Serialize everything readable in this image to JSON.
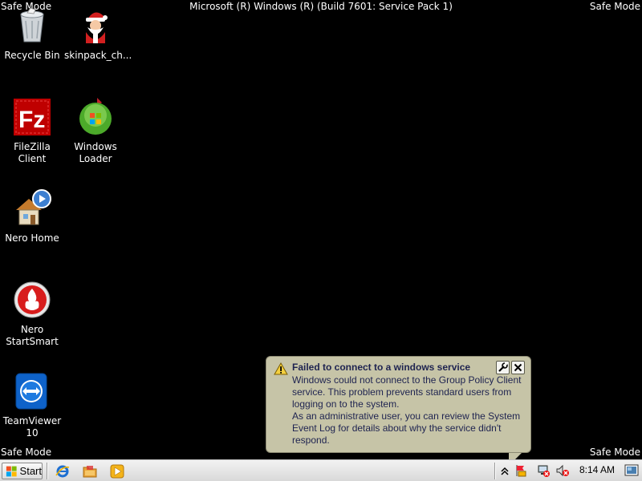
{
  "overlay": {
    "safe_mode_label": "Safe Mode",
    "build_text": "Microsoft (R) Windows (R) (Build 7601: Service Pack 1)"
  },
  "desktop": {
    "icons": [
      {
        "label": "Recycle Bin",
        "icon": "recycle-bin-icon"
      },
      {
        "label": "skinpack_ch...",
        "icon": "santa-icon"
      },
      {
        "label": "FileZilla Client",
        "icon": "filezilla-icon"
      },
      {
        "label": "Windows\nLoader",
        "icon": "windows-loader-icon"
      },
      {
        "label": "Nero Home",
        "icon": "nero-home-icon"
      },
      {
        "label": "Nero\nStartSmart",
        "icon": "nero-startsmart-icon"
      },
      {
        "label": "TeamViewer\n10",
        "icon": "teamviewer-icon"
      }
    ]
  },
  "balloon": {
    "title": "Failed to connect to a windows service",
    "body": "Windows could not connect to the Group Policy Client service. This problem prevents standard users from logging on to the system.\nAs an administrative user, you can review the System Event Log for details about why the service didn't respond.",
    "warning_icon": "warning-icon",
    "settings_icon": "settings-icon",
    "close_icon": "close-icon"
  },
  "taskbar": {
    "start_label": "Start",
    "quick_launch": [
      "internet-explorer-icon",
      "file-explorer-icon",
      "media-player-icon"
    ],
    "tray": {
      "icons": [
        "show-hidden-icons-icon",
        "action-center-icon",
        "network-disconnected-icon",
        "volume-muted-icon"
      ],
      "clock": "8:14 AM",
      "show_desktop_icon": "show-desktop-icon"
    }
  },
  "colors": {
    "desktop_bg": "#000000",
    "balloon_bg": "#c6c4a7",
    "balloon_text": "#1e2350",
    "taskbar_bg": "#e0e0e0"
  }
}
